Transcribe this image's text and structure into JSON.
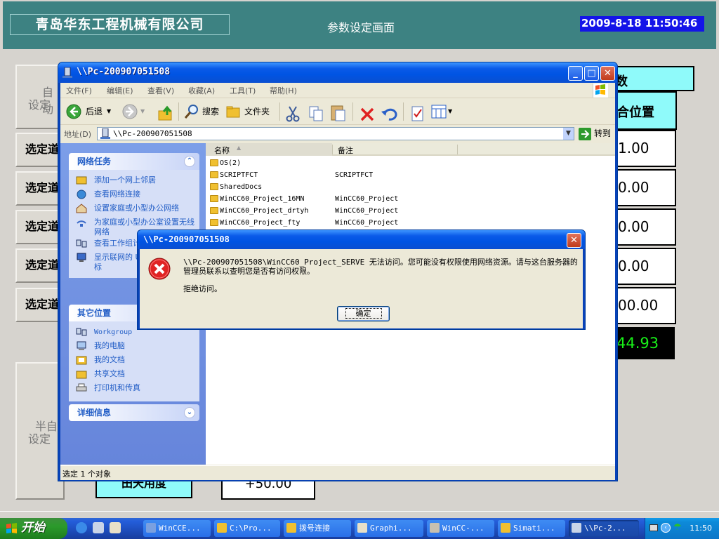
{
  "hmi": {
    "company": "青岛华东工程机械有限公司",
    "screen_title": "参数设定画面",
    "datetime": "2009-8-18 11:50:46",
    "panel_auto_line1": "自动",
    "panel_auto_line2": "设定",
    "panel_semi_line1": "半自",
    "panel_semi_line2": "设定",
    "select_label": "选定道",
    "header_right_top": "数",
    "header_right": "合位置",
    "values": [
      "1.00",
      "0.00",
      "0.00",
      "0.00",
      "00.00"
    ],
    "value_green": "44.93",
    "bottom_cyan": "田天用度",
    "bottom_white": "+50.00"
  },
  "explorer": {
    "title": "\\\\Pc-200907051508",
    "menu": [
      "文件(F)",
      "编辑(E)",
      "查看(V)",
      "收藏(A)",
      "工具(T)",
      "帮助(H)"
    ],
    "toolbar": {
      "back": "后退",
      "search": "搜索",
      "folders": "文件夹"
    },
    "address_label": "地址(D)",
    "address": "\\\\Pc-200907051508",
    "go": "转到",
    "network_tasks": {
      "title": "网络任务",
      "items": [
        "添加一个网上邻居",
        "查看网络连接",
        "设置家庭或小型办公网络",
        "为家庭或小型办公室设置无线网络",
        "查看工作组计算机",
        "显示联网的 UPnP 设备的图标"
      ]
    },
    "other_places": {
      "title": "其它位置",
      "items": [
        "Workgroup",
        "我的电脑",
        "我的文档",
        "共享文档",
        "打印机和传真"
      ]
    },
    "details": {
      "title": "详细信息"
    },
    "columns": {
      "name": "名称",
      "note": "备注"
    },
    "files": [
      {
        "name": "OS(2)",
        "note": ""
      },
      {
        "name": "SCRIPTFCT",
        "note": "SCRIPTFCT"
      },
      {
        "name": "SharedDocs",
        "note": ""
      },
      {
        "name": "WinCC60_Project_16MN",
        "note": "WinCC60_Project"
      },
      {
        "name": "WinCC60_Project_drtyh",
        "note": "WinCC60_Project"
      },
      {
        "name": "WinCC60_Project_fty",
        "note": "WinCC60_Project"
      }
    ],
    "status": "选定 1 个对象"
  },
  "dialog": {
    "title": "\\\\Pc-200907051508",
    "message": "\\\\Pc-200907051508\\WinCC60_Project_SERVE 无法访问。您可能没有权限使用网络资源。请与这台服务器的管理员联系以查明您是否有访问权限。",
    "detail": "拒绝访问。",
    "ok": "确定"
  },
  "taskbar": {
    "start": "开始",
    "tasks": [
      "WinCCE...",
      "C:\\Pro...",
      "拨号连接",
      "Graphi...",
      "WinCC-...",
      "Simati...",
      "\\\\Pc-2..."
    ],
    "clock": "11:50"
  },
  "colors": {
    "xp_blue": "#0054e3",
    "hmi_teal": "#3d8282",
    "hmi_cyan": "#8ffafa",
    "datetime_bg": "#1414e8",
    "value_green": "#18f018"
  }
}
